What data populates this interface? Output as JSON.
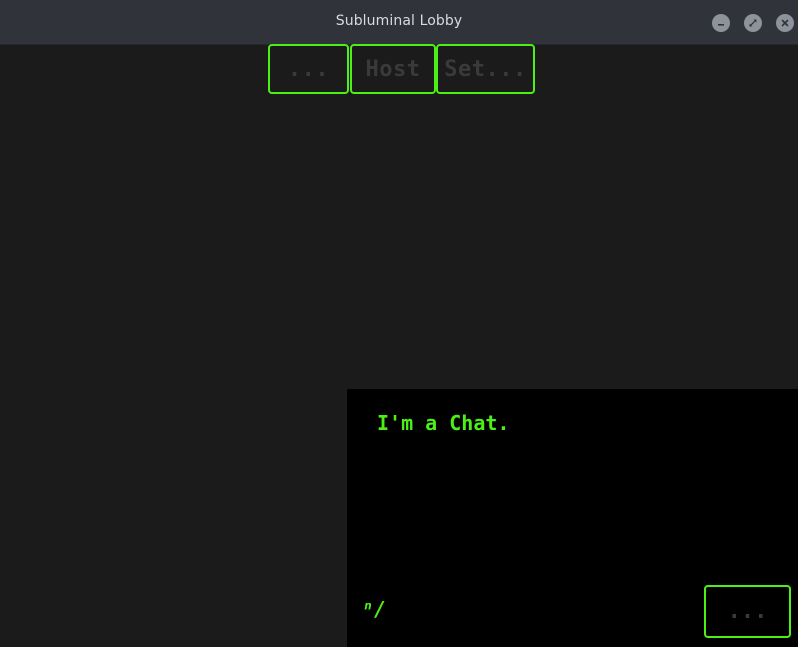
{
  "window": {
    "title": "Subluminal Lobby",
    "controls": [
      "minimize-icon",
      "maximize-icon",
      "close-icon"
    ]
  },
  "toolbar": {
    "more_label": "...",
    "host_label": "Host",
    "settings_label": "Set..."
  },
  "chat": {
    "message": "I'm a Chat.",
    "prompt": "ⁿ/",
    "send_label": "..."
  },
  "colors": {
    "accent": "#4cf017",
    "background": "#1b1b1b",
    "titlebar": "#30343a",
    "chat_bg": "#000000"
  }
}
